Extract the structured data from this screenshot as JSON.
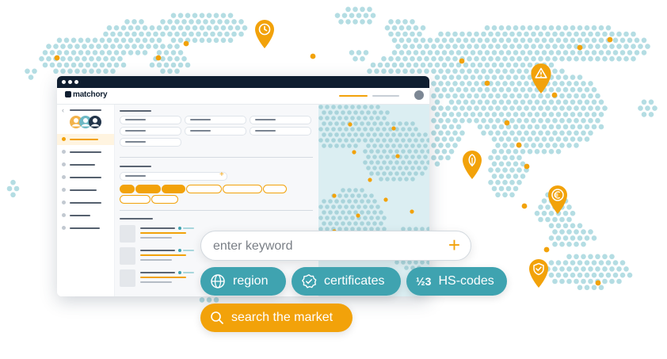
{
  "colors": {
    "dot": "#b4dde3",
    "accent": "#f2a20a",
    "teal": "#3fa3b0",
    "navy": "#0f1e30"
  },
  "map": {
    "markers": [
      "clock-icon",
      "warning-icon",
      "leaf-icon",
      "euro-icon",
      "check-shield-icon"
    ]
  },
  "app": {
    "logo": "matchory"
  },
  "search": {
    "placeholder": "enter keyword",
    "add_icon": "plus-icon"
  },
  "filters": [
    {
      "label": "region",
      "icon": "globe-icon"
    },
    {
      "label": "certificates",
      "icon": "badge-check-icon"
    },
    {
      "label": "HS-codes",
      "icon": "fraction-icon"
    }
  ],
  "search_button": {
    "label": "search the market",
    "icon": "search-icon"
  }
}
